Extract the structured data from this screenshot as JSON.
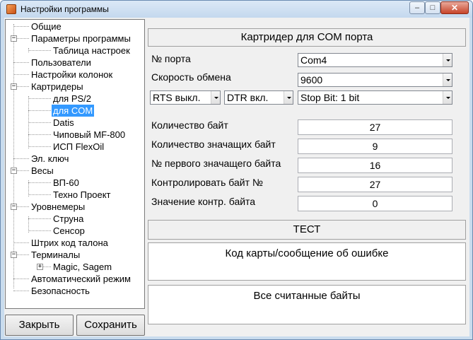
{
  "window": {
    "title": "Настройки программы",
    "controls": {
      "minimize": "–",
      "maximize": "□",
      "close": "✕"
    }
  },
  "tree": {
    "items": [
      {
        "label": "Общие"
      },
      {
        "label": "Параметры программы"
      },
      {
        "label": "Таблица настроек"
      },
      {
        "label": "Пользователи"
      },
      {
        "label": "Настройки колонок"
      },
      {
        "label": "Картридеры"
      },
      {
        "label": "для PS/2"
      },
      {
        "label": "для COM"
      },
      {
        "label": "Datis"
      },
      {
        "label": "Чиповый MF-800"
      },
      {
        "label": "ИСП FlexOil"
      },
      {
        "label": "Эл. ключ"
      },
      {
        "label": "Весы"
      },
      {
        "label": "ВП-60"
      },
      {
        "label": "Техно Проект"
      },
      {
        "label": "Уровнемеры"
      },
      {
        "label": "Струна"
      },
      {
        "label": "Сенсор"
      },
      {
        "label": "Штрих код талона"
      },
      {
        "label": "Терминалы"
      },
      {
        "label": "Magic, Sagem"
      },
      {
        "label": "Автоматический режим"
      },
      {
        "label": "Безопасность"
      }
    ],
    "expander_collapsed": "+",
    "expander_expanded": "−"
  },
  "buttons": {
    "close": "Закрыть",
    "save": "Сохранить"
  },
  "panel": {
    "header": "Картридер для COM порта",
    "port_label": "№ порта",
    "port_value": "Com4",
    "speed_label": "Скорость обмена",
    "speed_value": "9600",
    "rts_value": "RTS выкл.",
    "dtr_value": "DTR вкл.",
    "stopbit_value": "Stop Bit: 1 bit",
    "fields": [
      {
        "label": "Количество байт",
        "value": "27"
      },
      {
        "label": "Количество значащих  байт",
        "value": "9"
      },
      {
        "label": "№ первого значащего байта",
        "value": "16"
      },
      {
        "label": "Контролировать байт №",
        "value": "27"
      },
      {
        "label": "Значение контр. байта",
        "value": "0"
      }
    ],
    "test_button": "ТЕСТ",
    "card_box": "Код карты/сообщение об ошибке",
    "bytes_box": "Все считанные байты"
  }
}
